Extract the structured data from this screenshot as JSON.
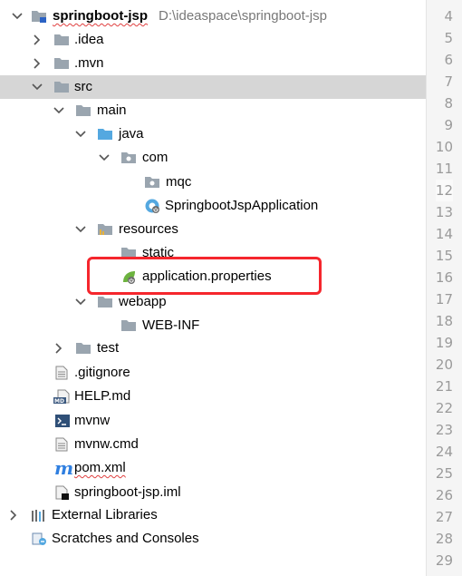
{
  "project": {
    "name": "springboot-jsp",
    "path": "D:\\ideaspace\\springboot-jsp"
  },
  "tree": {
    "idea": ".idea",
    "mvn": ".mvn",
    "src": "src",
    "main": "main",
    "java": "java",
    "com": "com",
    "mqc": "mqc",
    "app_class": "SpringbootJspApplication",
    "resources": "resources",
    "static": "static",
    "app_props": "application.properties",
    "webapp": "webapp",
    "webinf": "WEB-INF",
    "test": "test",
    "gitignore": ".gitignore",
    "helpmd": "HELP.md",
    "mvnw": "mvnw",
    "mvnwcmd": "mvnw.cmd",
    "pom": "pom.xml",
    "iml": "springboot-jsp.iml",
    "ext_libs": "External Libraries",
    "scratches": "Scratches and Consoles"
  },
  "icons": {
    "md_badge": "MD",
    "pom_glyph": "m"
  },
  "gutter": {
    "line_numbers": [
      "4",
      "5",
      "6",
      "7",
      "8",
      "9",
      "10",
      "11",
      "12",
      "13",
      "14",
      "15",
      "16",
      "17",
      "18",
      "19",
      "20",
      "21",
      "22",
      "23",
      "24",
      "25",
      "26",
      "27",
      "28",
      "29"
    ],
    "current_line": "12"
  },
  "colors": {
    "folder": "#9aa5af",
    "source_folder": "#54a8e0",
    "spring_green": "#6db33f",
    "highlight": "#f5262d",
    "selection": "#d6d6d6"
  }
}
